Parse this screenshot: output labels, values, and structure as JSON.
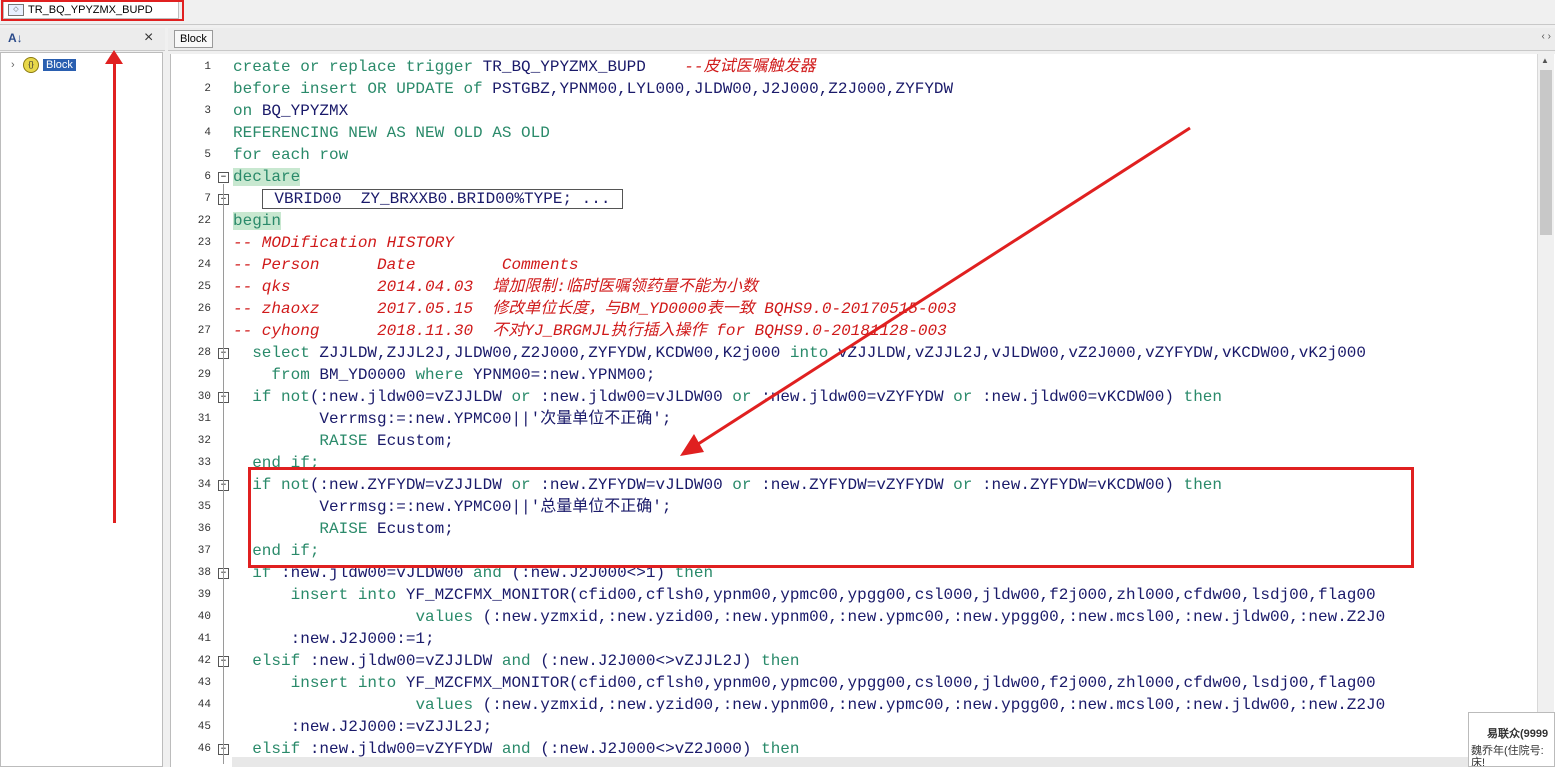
{
  "document_tab": {
    "title": "TR_BQ_YPYZMX_BUPD"
  },
  "left_panel": {
    "tree_item": "Block"
  },
  "editor_tab": {
    "label": "Block"
  },
  "editor": {
    "lines": [
      {
        "num": "1",
        "segs": [
          {
            "t": "create or replace trigger ",
            "c": "kw"
          },
          {
            "t": "TR_BQ_YPYZMX_BUPD"
          },
          {
            "t": "    --皮试医嘱触发器",
            "c": "cm"
          }
        ]
      },
      {
        "num": "2",
        "segs": [
          {
            "t": "before insert OR UPDATE of ",
            "c": "kw"
          },
          {
            "t": "PSTGBZ,YPNM00,LYL000,JLDW00,J2J000,Z2J000,ZYFYDW"
          }
        ]
      },
      {
        "num": "3",
        "segs": [
          {
            "t": "on ",
            "c": "kw"
          },
          {
            "t": "BQ_YPYZMX"
          }
        ]
      },
      {
        "num": "4",
        "segs": [
          {
            "t": "REFERENCING NEW AS NEW OLD AS OLD",
            "c": "kw"
          }
        ]
      },
      {
        "num": "5",
        "segs": [
          {
            "t": "for each row",
            "c": "kw"
          }
        ]
      },
      {
        "num": "6",
        "fold": "−",
        "segs": [
          {
            "t": "declare",
            "c": "kw hl"
          }
        ]
      },
      {
        "num": "7",
        "fold": "+",
        "segs": [
          {
            "t": "   "
          },
          {
            "t": " VBRID00  ZY_BRXXB0.BRID00%TYPE; ... ",
            "c": "collapsed-box"
          }
        ]
      },
      {
        "num": "22",
        "segs": [
          {
            "t": "begin",
            "c": "kw hl"
          }
        ]
      },
      {
        "num": "23",
        "segs": [
          {
            "t": "-- MODification HISTORY",
            "c": "cm"
          }
        ]
      },
      {
        "num": "24",
        "segs": [
          {
            "t": "-- Person      Date         Comments",
            "c": "cm"
          }
        ]
      },
      {
        "num": "25",
        "segs": [
          {
            "t": "-- qks         2014.04.03  增加限制:临时医嘱领药量不能为小数",
            "c": "cm"
          }
        ]
      },
      {
        "num": "26",
        "segs": [
          {
            "t": "-- zhaoxz      2017.05.15  修改单位长度，与BM_YD0000表一致 BQHS9.0-20170515-003",
            "c": "cm"
          }
        ]
      },
      {
        "num": "27",
        "segs": [
          {
            "t": "-- cyhong      2018.11.30  不对YJ_BRGMJL执行插入操作 for BQHS9.0-20181128-003",
            "c": "cm"
          }
        ]
      },
      {
        "num": "28",
        "fold": "−",
        "segs": [
          {
            "t": "  select ",
            "c": "kw"
          },
          {
            "t": "ZJJLDW,ZJJL2J,JLDW00,Z2J000,ZYFYDW,KCDW00,K2j000 "
          },
          {
            "t": "into ",
            "c": "kw"
          },
          {
            "t": "vZJJLDW,vZJJL2J,vJLDW00,vZ2J000,vZYFYDW,vKCDW00,vK2j000"
          }
        ]
      },
      {
        "num": "29",
        "segs": [
          {
            "t": "    from ",
            "c": "kw"
          },
          {
            "t": "BM_YD0000 "
          },
          {
            "t": "where ",
            "c": "kw"
          },
          {
            "t": "YPNM00=:new.YPNM00;"
          }
        ]
      },
      {
        "num": "30",
        "fold": "−",
        "segs": [
          {
            "t": "  if not",
            "c": "kw"
          },
          {
            "t": "(:new.jldw00=vZJJLDW "
          },
          {
            "t": "or ",
            "c": "kw"
          },
          {
            "t": ":new.jldw00=vJLDW00 "
          },
          {
            "t": "or ",
            "c": "kw"
          },
          {
            "t": ":new.jldw00=vZYFYDW "
          },
          {
            "t": "or ",
            "c": "kw"
          },
          {
            "t": ":new.jldw00=vKCDW00) "
          },
          {
            "t": "then",
            "c": "kw"
          }
        ]
      },
      {
        "num": "31",
        "segs": [
          {
            "t": "         Verrmsg:=:new.YPMC00||'次量单位不正确';"
          }
        ]
      },
      {
        "num": "32",
        "segs": [
          {
            "t": "         "
          },
          {
            "t": "RAISE ",
            "c": "kw"
          },
          {
            "t": "Ecustom;"
          }
        ]
      },
      {
        "num": "33",
        "segs": [
          {
            "t": "  end if;",
            "c": "kw"
          }
        ]
      },
      {
        "num": "34",
        "fold": "−",
        "segs": [
          {
            "t": "  if not",
            "c": "kw"
          },
          {
            "t": "(:new.ZYFYDW=vZJJLDW "
          },
          {
            "t": "or ",
            "c": "kw"
          },
          {
            "t": ":new.ZYFYDW=vJLDW00 "
          },
          {
            "t": "or ",
            "c": "kw"
          },
          {
            "t": ":new.ZYFYDW=vZYFYDW "
          },
          {
            "t": "or ",
            "c": "kw"
          },
          {
            "t": ":new.ZYFYDW=vKCDW00) "
          },
          {
            "t": "then",
            "c": "kw"
          }
        ]
      },
      {
        "num": "35",
        "segs": [
          {
            "t": "         Verrmsg:=:new.YPMC00||'总量单位不正确';"
          }
        ]
      },
      {
        "num": "36",
        "segs": [
          {
            "t": "         "
          },
          {
            "t": "RAISE ",
            "c": "kw"
          },
          {
            "t": "Ecustom;"
          }
        ]
      },
      {
        "num": "37",
        "segs": [
          {
            "t": "  end if;",
            "c": "kw"
          }
        ]
      },
      {
        "num": "38",
        "fold": "−",
        "segs": [
          {
            "t": "  if ",
            "c": "kw"
          },
          {
            "t": ":new.jldw00=vJLDW00 "
          },
          {
            "t": "and ",
            "c": "kw"
          },
          {
            "t": "(:new.J2J000<>1) "
          },
          {
            "t": "then",
            "c": "kw"
          }
        ]
      },
      {
        "num": "39",
        "segs": [
          {
            "t": "      insert into ",
            "c": "kw"
          },
          {
            "t": "YF_MZCFMX_MONITOR(cfid00,cflsh0,ypnm00,ypmc00,ypgg00,csl000,jldw00,f2j000,zhl000,cfdw00,lsdj00,flag00"
          }
        ]
      },
      {
        "num": "40",
        "segs": [
          {
            "t": "                   "
          },
          {
            "t": "values ",
            "c": "kw"
          },
          {
            "t": "(:new.yzmxid,:new.yzid00,:new.ypnm00,:new.ypmc00,:new.ypgg00,:new.mcsl00,:new.jldw00,:new.Z2J0"
          }
        ]
      },
      {
        "num": "41",
        "segs": [
          {
            "t": "      :new.J2J000:=1;"
          }
        ]
      },
      {
        "num": "42",
        "fold": "−",
        "segs": [
          {
            "t": "  elsif ",
            "c": "kw"
          },
          {
            "t": ":new.jldw00=vZJJLDW "
          },
          {
            "t": "and ",
            "c": "kw"
          },
          {
            "t": "(:new.J2J000<>vZJJL2J) "
          },
          {
            "t": "then",
            "c": "kw"
          }
        ]
      },
      {
        "num": "43",
        "segs": [
          {
            "t": "      insert into ",
            "c": "kw"
          },
          {
            "t": "YF_MZCFMX_MONITOR(cfid00,cflsh0,ypnm00,ypmc00,ypgg00,csl000,jldw00,f2j000,zhl000,cfdw00,lsdj00,flag00"
          }
        ]
      },
      {
        "num": "44",
        "segs": [
          {
            "t": "                   "
          },
          {
            "t": "values ",
            "c": "kw"
          },
          {
            "t": "(:new.yzmxid,:new.yzid00,:new.ypnm00,:new.ypmc00,:new.ypgg00,:new.mcsl00,:new.jldw00,:new.Z2J0"
          }
        ]
      },
      {
        "num": "45",
        "segs": [
          {
            "t": "      :new.J2J000:=vZJJL2J;"
          }
        ]
      },
      {
        "num": "46",
        "fold": "−",
        "segs": [
          {
            "t": "  elsif ",
            "c": "kw"
          },
          {
            "t": ":new.jldw00=vZYFYDW "
          },
          {
            "t": "and ",
            "c": "kw"
          },
          {
            "t": "(:new.J2J000<>vZ2J000) "
          },
          {
            "t": "then",
            "c": "kw"
          }
        ]
      }
    ]
  },
  "popup": {
    "title": "易联众(9999",
    "text": "魏乔年(住院号:\n床!"
  }
}
